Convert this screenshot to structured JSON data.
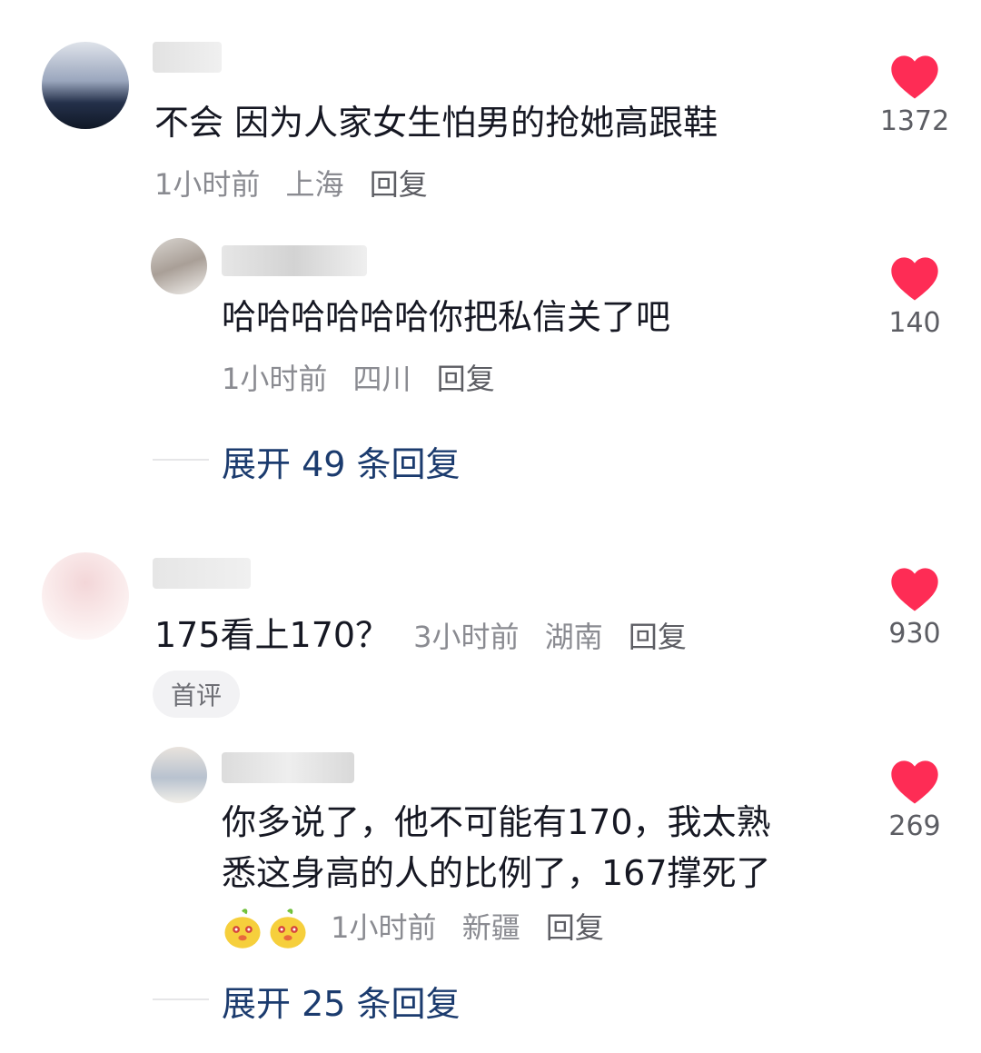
{
  "comments": [
    {
      "text": "不会 因为人家女生怕男的抢她高跟鞋",
      "time": "1小时前",
      "location": "上海",
      "reply_label": "回复",
      "likes": "1372",
      "replies": [
        {
          "text": "哈哈哈哈哈哈你把私信关了吧",
          "time": "1小时前",
          "location": "四川",
          "reply_label": "回复",
          "likes": "140"
        }
      ],
      "expand_label": "展开 49 条回复"
    },
    {
      "text": "175看上170？",
      "time": "3小时前",
      "location": "湖南",
      "reply_label": "回复",
      "likes": "930",
      "badge": "首评",
      "replies": [
        {
          "text_line1": "你多说了，他不可能有170，我太熟",
          "text_line2": "悉这身高的人的比例了，167撑死了",
          "time": "1小时前",
          "location": "新疆",
          "reply_label": "回复",
          "likes": "269",
          "emojis": [
            "chick-emoji",
            "chick-emoji"
          ]
        }
      ],
      "expand_label": "展开 25 条回复"
    }
  ],
  "colors": {
    "like": "#fe2c55",
    "expand": "#1b3b6e",
    "meta": "#8a8b91"
  }
}
